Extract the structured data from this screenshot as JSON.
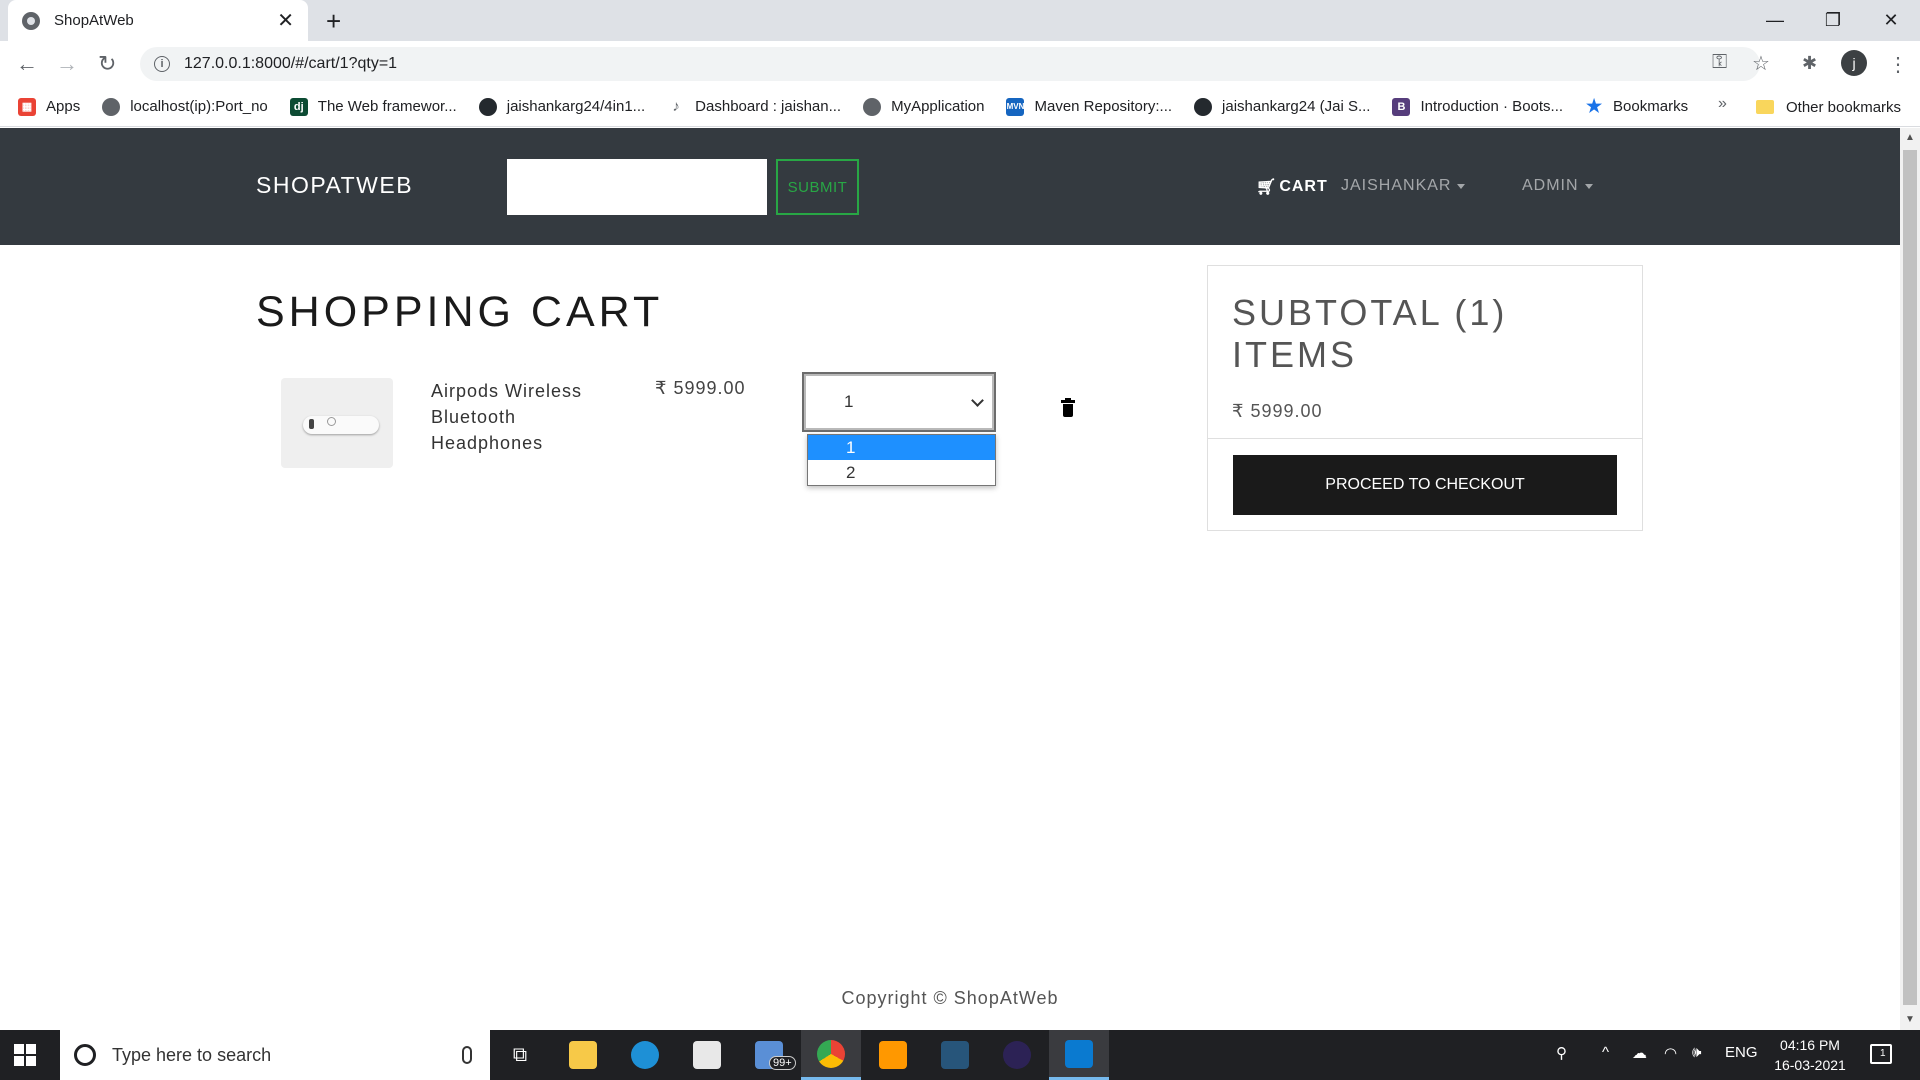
{
  "browser": {
    "tab_title": "ShopAtWeb",
    "tab_close": "✕",
    "new_tab": "+",
    "url": "127.0.0.1:8000/#/cart/1?qty=1",
    "bookmarks": [
      {
        "label": "Apps",
        "icon": "apps-grid-icon",
        "color": "#ea4335"
      },
      {
        "label": "localhost(ip):Port_no",
        "icon": "globe-icon",
        "color": "#5f6368"
      },
      {
        "label": "The Web framewor...",
        "icon": "django-icon",
        "color": "#0c4b33"
      },
      {
        "label": "jaishankarg24/4in1...",
        "icon": "github-icon",
        "color": "#24292e"
      },
      {
        "label": "Dashboard : jaishan...",
        "icon": "dashboard-icon",
        "color": "#5f6368"
      },
      {
        "label": "MyApplication",
        "icon": "globe-icon",
        "color": "#5f6368"
      },
      {
        "label": "Maven Repository:...",
        "icon": "maven-icon",
        "color": "#1565c0"
      },
      {
        "label": "jaishankarg24 (Jai S...",
        "icon": "github-icon",
        "color": "#24292e"
      },
      {
        "label": "Introduction · Boots...",
        "icon": "bootstrap-icon",
        "color": "#563d7c"
      },
      {
        "label": "Bookmarks",
        "icon": "star-icon",
        "color": "#1a73e8"
      }
    ],
    "bookmarks_more": "»",
    "other_bookmarks": "Other bookmarks",
    "profile_initial": "j"
  },
  "site": {
    "brand": "SHOPATWEB",
    "search_placeholder": "",
    "submit_label": "SUBMIT",
    "nav": {
      "cart": "CART",
      "user": "JAISHANKAR",
      "admin": "ADMIN"
    },
    "accent_color": "#28a745",
    "navbar_color": "#343a40"
  },
  "cart": {
    "title": "SHOPPING CART",
    "items": [
      {
        "name": "Airpods Wireless Bluetooth Headphones",
        "price": "₹ 5999.00",
        "qty": "1",
        "qty_options": [
          "1",
          "2"
        ],
        "selected_option": "1"
      }
    ]
  },
  "summary": {
    "title": "SUBTOTAL (1) ITEMS",
    "price": "₹ 5999.00",
    "checkout_label": "PROCEED TO CHECKOUT"
  },
  "footer": {
    "copyright": "Copyright © ShopAtWeb"
  },
  "taskbar": {
    "search_placeholder": "Type here to search",
    "mail_badge": "99+",
    "language": "ENG",
    "time": "04:16 PM",
    "date": "16-03-2021",
    "notification_count": "1"
  }
}
